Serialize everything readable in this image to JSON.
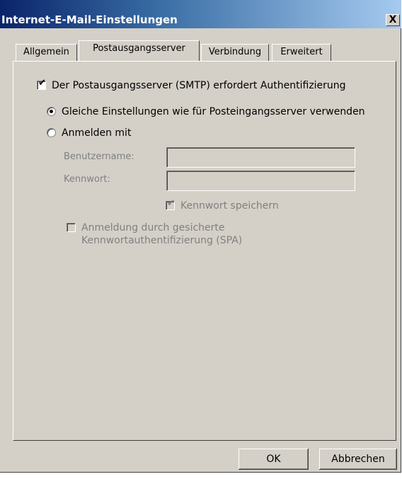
{
  "window": {
    "title": "Internet-E-Mail-Einstellungen",
    "close_glyph": "X"
  },
  "tabs": [
    {
      "label": "Allgemein",
      "active": false
    },
    {
      "label": "Postausgangsserver",
      "active": true
    },
    {
      "label": "Verbindung",
      "active": false
    },
    {
      "label": "Erweitert",
      "active": false
    }
  ],
  "panel": {
    "smtp_auth_label": "Der Postausgangsserver (SMTP) erfordert Authentifizierung",
    "smtp_auth_checked": true,
    "same_settings_label": "Gleiche Einstellungen wie für Posteingangsserver verwenden",
    "same_settings_selected": true,
    "login_with_label": "Anmelden mit",
    "login_with_selected": false,
    "username_label": "Benutzername:",
    "username_value": "",
    "password_label": "Kennwort:",
    "password_value": "",
    "save_password_label": "Kennwort speichern",
    "save_password_checked": true,
    "spa_label_line1": "Anmeldung durch gesicherte",
    "spa_label_line2": "Kennwortauthentifizierung (SPA)",
    "spa_checked": false
  },
  "buttons": {
    "ok": "OK",
    "cancel": "Abbrechen"
  },
  "colors": {
    "dialog_bg": "#d4d0c8",
    "title_start": "#0a246a",
    "title_end": "#a6caf0"
  }
}
